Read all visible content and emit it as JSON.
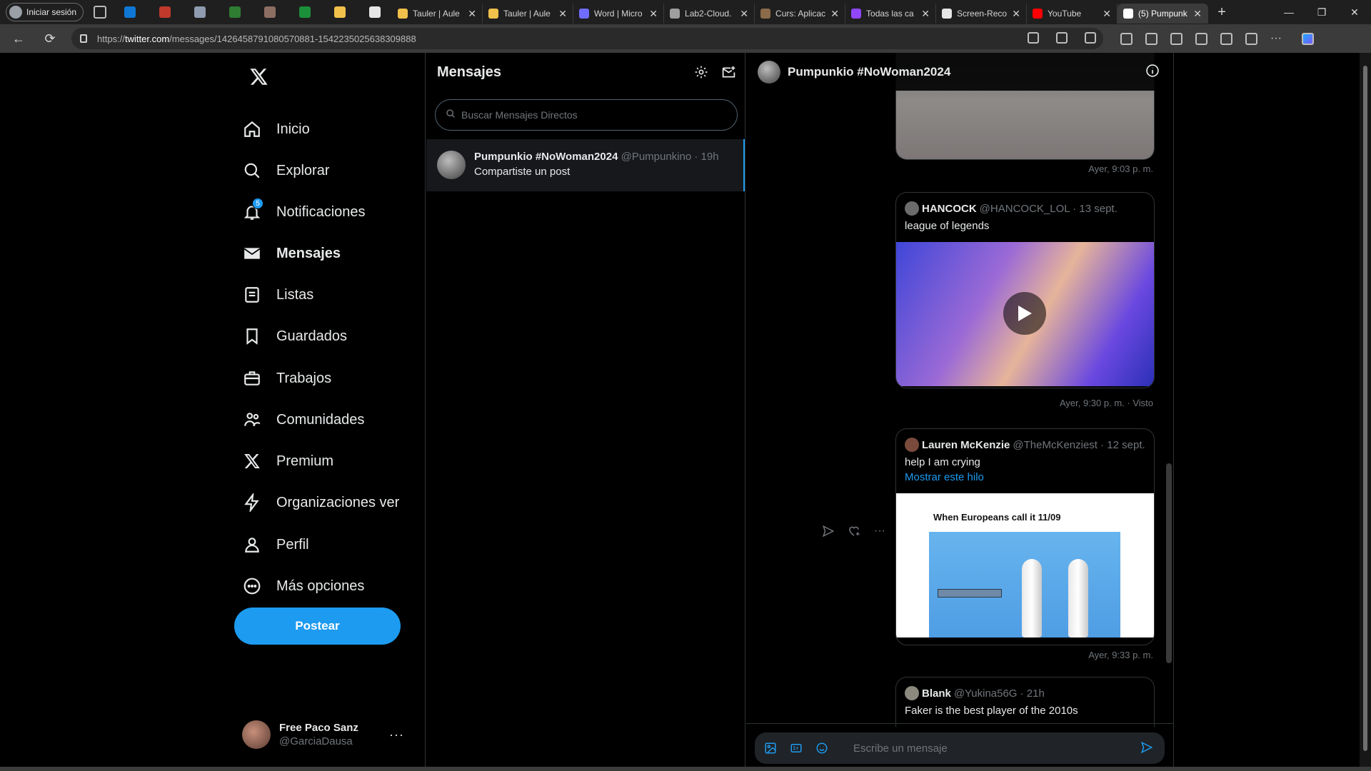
{
  "browser": {
    "profile_label": "Iniciar sesión",
    "url_prefix": "https://",
    "url_host": "twitter.com",
    "url_path": "/messages/1426458791080570881-1542235025638309888",
    "tabs": [
      {
        "title": "Tauler | Aule",
        "color": "#f1c14b"
      },
      {
        "title": "Tauler | Aule",
        "color": "#f1c14b"
      },
      {
        "title": "Word | Micro",
        "color": "#6f6cff"
      },
      {
        "title": "Lab2-Cloud.",
        "color": "#9e9e9e"
      },
      {
        "title": "Curs: Aplicac",
        "color": "#8b6b4a"
      },
      {
        "title": "Todas las ca",
        "color": "#9146ff"
      },
      {
        "title": "Screen-Reco",
        "color": "#e6e6e6"
      },
      {
        "title": "YouTube",
        "color": "#ff0000"
      },
      {
        "title": "(5) Pumpunk",
        "color": "#ffffff"
      }
    ],
    "pinned_colors": [
      "#0f78d4",
      "#c0392b",
      "#8e9bb0",
      "#2e7d32",
      "#8d6e63",
      "#1b8f3a",
      "#f1c14b",
      "#e6e6e6"
    ]
  },
  "nav": {
    "items": [
      {
        "label": "Inicio",
        "icon": "home-icon"
      },
      {
        "label": "Explorar",
        "icon": "search-icon"
      },
      {
        "label": "Notificaciones",
        "icon": "bell-icon",
        "badge": "5"
      },
      {
        "label": "Mensajes",
        "icon": "envelope-icon",
        "active": true
      },
      {
        "label": "Listas",
        "icon": "list-icon"
      },
      {
        "label": "Guardados",
        "icon": "bookmark-icon"
      },
      {
        "label": "Trabajos",
        "icon": "briefcase-icon"
      },
      {
        "label": "Comunidades",
        "icon": "communities-icon"
      },
      {
        "label": "Premium",
        "icon": "x-logo-icon"
      },
      {
        "label": "Organizaciones ver",
        "icon": "lightning-icon"
      },
      {
        "label": "Perfil",
        "icon": "person-icon"
      },
      {
        "label": "Más opciones",
        "icon": "more-circle-icon"
      }
    ],
    "post_label": "Postear",
    "account": {
      "name": "Free Paco Sanz",
      "handle": "@GarciaDausa"
    }
  },
  "messages": {
    "title": "Mensajes",
    "search_placeholder": "Buscar Mensajes Directos",
    "conversation": {
      "name": "Pumpunkio #NoWoman2024",
      "handle": "@Pumpunkino · 19h",
      "preview": "Compartiste un post"
    }
  },
  "chat": {
    "title": "Pumpunkio #NoWoman2024",
    "meta1": "Ayer, 9:03 p. m.",
    "card2": {
      "name": "HANCOCK",
      "handle": "@HANCOCK_LOL · 13 sept.",
      "text": "league of legends"
    },
    "meta2": "Ayer, 9:30 p. m. · Visto",
    "card3": {
      "name": "Lauren McKenzie",
      "handle": "@TheMcKenziest · 12 sept.",
      "text": "help I am crying",
      "link": "Mostrar este hilo",
      "image_caption": "When Europeans call it 11/09"
    },
    "meta3": "Ayer, 9:33 p. m.",
    "card4": {
      "name": "Blank",
      "handle": "@Yukina56G · 21h",
      "text": "Faker is the best player of the 2010s"
    },
    "composer_placeholder": "Escribe un mensaje"
  },
  "colors": {
    "accent": "#1d9bf0",
    "background": "#000000",
    "border": "#2f3336",
    "muted": "#71767b"
  }
}
